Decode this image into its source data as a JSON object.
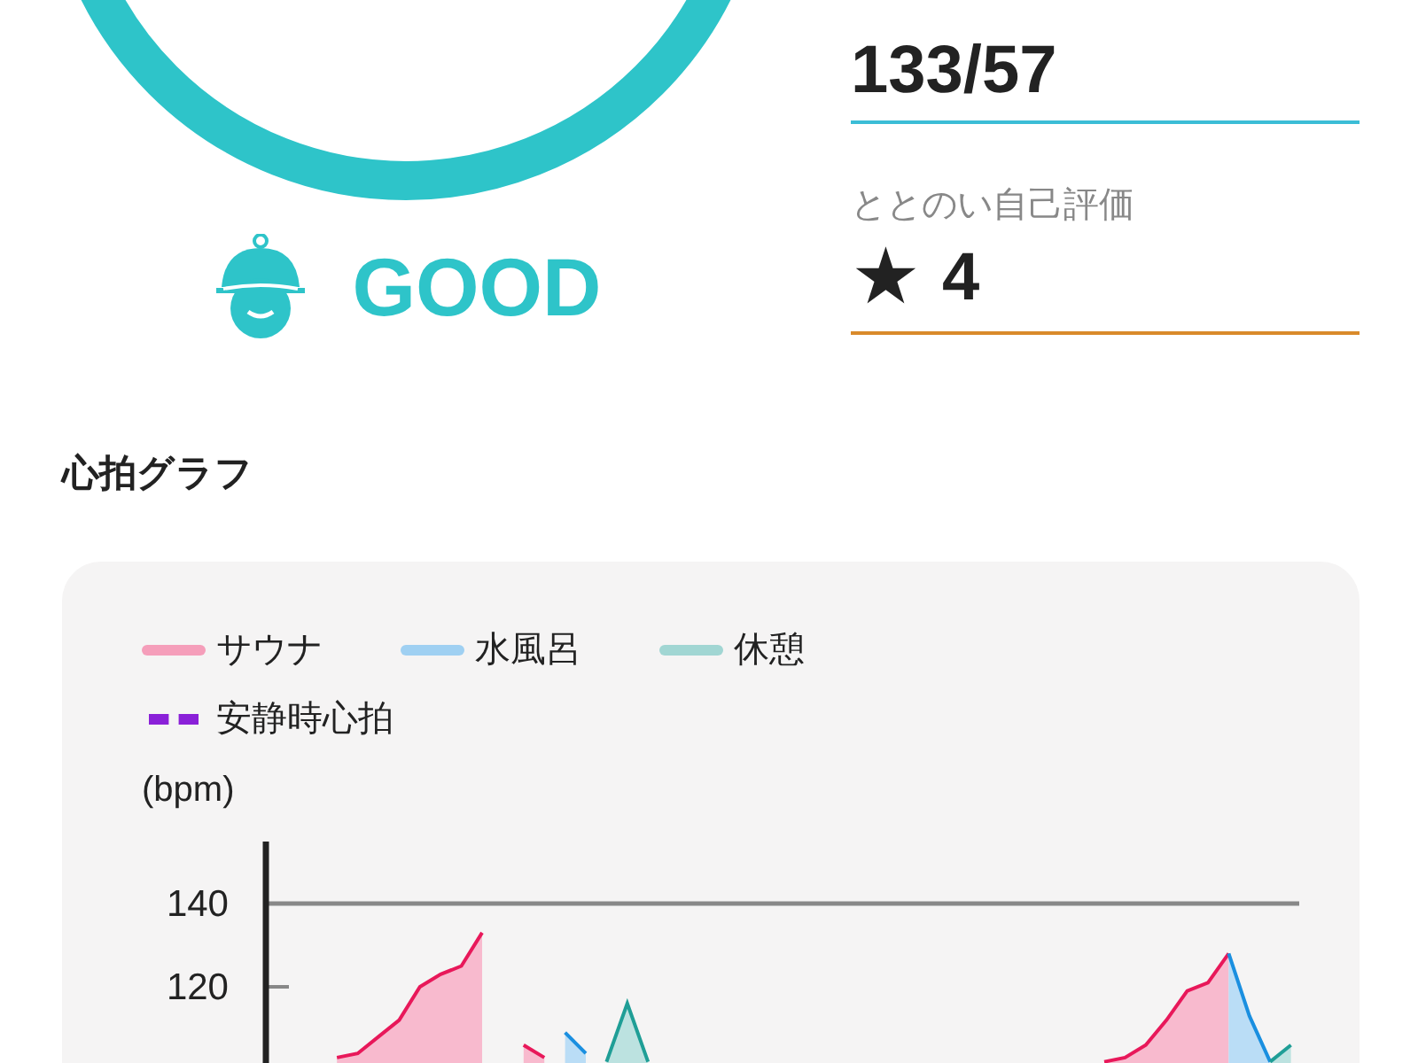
{
  "status": {
    "label": "GOOD",
    "color": "#2ec4c9"
  },
  "metrics": [
    {
      "value": "133/57",
      "color": "#3bbdd6"
    },
    {
      "label": "ととのい自己評価",
      "icon": "★",
      "value": "4",
      "color": "#d98a2b"
    }
  ],
  "heart_chart": {
    "title": "心拍グラフ",
    "resting_legend": {
      "label": "安静時心拍",
      "color": "#8a20d8"
    },
    "chart_data": {
      "type": "area",
      "ylabel": "(bpm)",
      "yticks": [
        120,
        140
      ],
      "ylim": [
        99,
        155
      ],
      "series": [
        {
          "name": "サウナ",
          "color": "#e8185a",
          "values": [
            null,
            null,
            null,
            103,
            104,
            108,
            112,
            120,
            123,
            125,
            133,
            null,
            106,
            103,
            null,
            null,
            null,
            null,
            null,
            null,
            null,
            null,
            null,
            null,
            null,
            null,
            null,
            null,
            null,
            null,
            null,
            null,
            null,
            null,
            null,
            null,
            null,
            null,
            null,
            null,
            102,
            103,
            106,
            112,
            119,
            121,
            128,
            null,
            null,
            null
          ]
        },
        {
          "name": "水風呂",
          "color": "#1a8fe0",
          "values": [
            null,
            null,
            null,
            null,
            null,
            null,
            null,
            null,
            null,
            null,
            null,
            null,
            null,
            null,
            109,
            104,
            null,
            null,
            null,
            null,
            null,
            null,
            null,
            null,
            null,
            null,
            null,
            null,
            null,
            null,
            null,
            null,
            null,
            null,
            null,
            null,
            null,
            null,
            null,
            null,
            null,
            null,
            null,
            null,
            null,
            null,
            128,
            113,
            102,
            null
          ]
        },
        {
          "name": "休憩",
          "color": "#1f9e96",
          "values": [
            null,
            null,
            null,
            null,
            null,
            null,
            null,
            null,
            null,
            null,
            null,
            null,
            null,
            null,
            null,
            null,
            102,
            116,
            102,
            null,
            null,
            null,
            null,
            null,
            null,
            null,
            null,
            null,
            null,
            null,
            null,
            null,
            null,
            null,
            null,
            null,
            null,
            null,
            null,
            null,
            null,
            null,
            null,
            null,
            null,
            null,
            null,
            null,
            102,
            106
          ]
        }
      ]
    }
  }
}
